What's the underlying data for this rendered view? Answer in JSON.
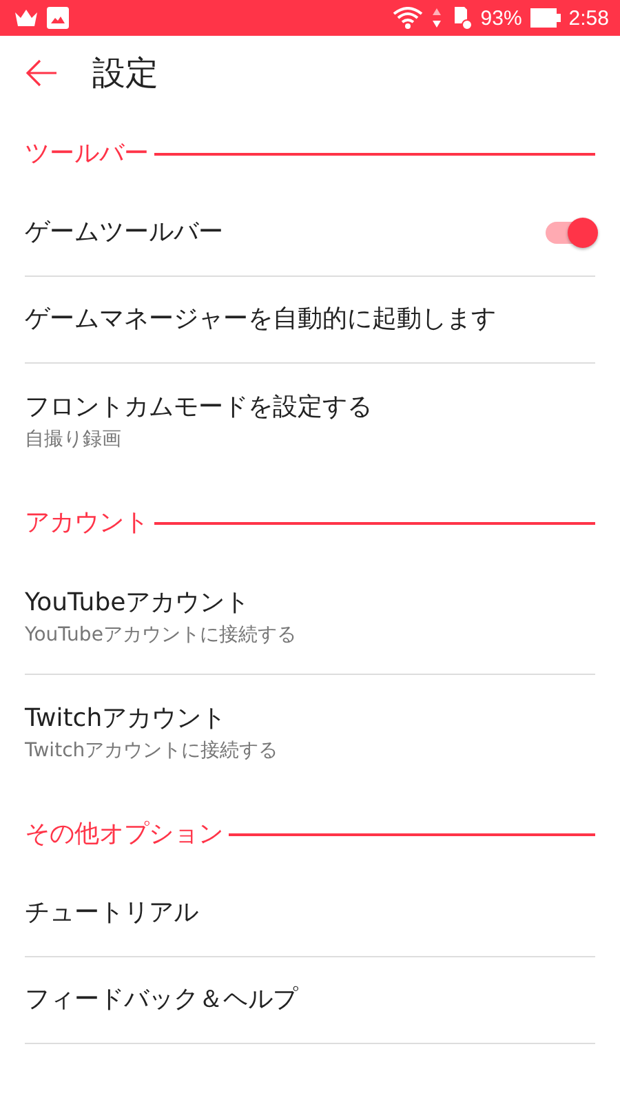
{
  "status_bar": {
    "battery": "93%",
    "time": "2:58"
  },
  "app_bar": {
    "title": "設定"
  },
  "sections": [
    {
      "title": "ツールバー",
      "items": [
        {
          "kind": "switch",
          "title": "ゲームツールバー",
          "on": true
        },
        {
          "kind": "plain",
          "title": "ゲームマネージャーを自動的に起動します"
        },
        {
          "kind": "plain",
          "title": "フロントカムモードを設定する",
          "subtitle": "自撮り録画"
        }
      ]
    },
    {
      "title": "アカウント",
      "items": [
        {
          "kind": "plain",
          "title": "YouTubeアカウント",
          "subtitle": "YouTubeアカウントに接続する"
        },
        {
          "kind": "plain",
          "title": "Twitchアカウント",
          "subtitle": "Twitchアカウントに接続する"
        }
      ]
    },
    {
      "title": "その他オプション",
      "items": [
        {
          "kind": "plain",
          "title": "チュートリアル"
        },
        {
          "kind": "plain",
          "title": "フィードバック＆ヘルプ"
        }
      ]
    }
  ]
}
